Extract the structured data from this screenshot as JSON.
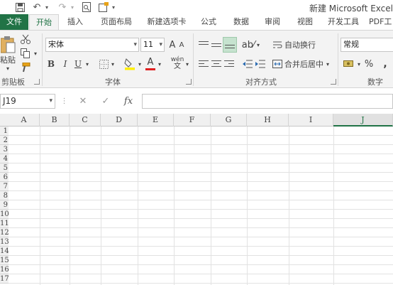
{
  "app": {
    "window_title": "新建 Microsoft Excel",
    "accent": "#217346"
  },
  "quick_access": {
    "save_icon": "save-icon",
    "undo_icon": "undo-icon",
    "redo_icon": "redo-icon",
    "print_preview_icon": "print-preview-icon",
    "new_icon": "new-document-icon"
  },
  "tabs": [
    {
      "label": "文件"
    },
    {
      "label": "开始"
    },
    {
      "label": "插入"
    },
    {
      "label": "页面布局"
    },
    {
      "label": "新建选项卡"
    },
    {
      "label": "公式"
    },
    {
      "label": "数据"
    },
    {
      "label": "审阅"
    },
    {
      "label": "视图"
    },
    {
      "label": "开发工具"
    },
    {
      "label": "PDF工"
    }
  ],
  "ribbon": {
    "clipboard": {
      "paste_label": "粘贴",
      "group_label": "剪贴板"
    },
    "font": {
      "font_name": "宋体",
      "font_size": "11",
      "bold": "B",
      "italic": "I",
      "underline": "U",
      "grow": "A",
      "shrink": "A",
      "phonetic": "wén",
      "font_color_letter": "A",
      "font_color": "#e02020",
      "fill_color": "#ffee00",
      "group_label": "字体"
    },
    "alignment": {
      "wrap_text": "自动换行",
      "merge_center": "合并后居中",
      "group_label": "对齐方式"
    },
    "number": {
      "format": "常规",
      "percent": "%",
      "comma": ",",
      "group_label": "数字"
    }
  },
  "formula_bar": {
    "name_box": "J19",
    "cancel_icon": "✕",
    "enter_icon": "✓",
    "fx": "fx",
    "value": ""
  },
  "sheet": {
    "columns": [
      "A",
      "B",
      "C",
      "D",
      "E",
      "F",
      "G",
      "H",
      "I",
      "J"
    ],
    "selected_column": "J",
    "rows": [
      "1",
      "2",
      "3",
      "4",
      "5",
      "6",
      "7",
      "8",
      "9",
      "10",
      "11",
      "12",
      "13",
      "14",
      "15",
      "16",
      "17"
    ]
  }
}
